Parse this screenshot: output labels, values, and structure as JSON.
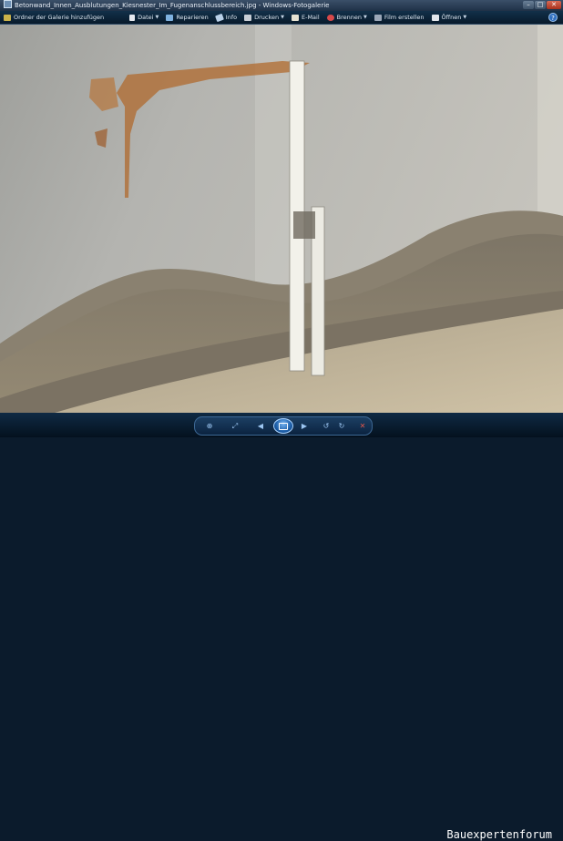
{
  "window": {
    "title": "Betonwand_Innen_Ausblutungen_Kiesnester_Im_Fugenanschlussbereich.jpg - Windows-Fotogalerie"
  },
  "toolbar": {
    "items": [
      {
        "label": "Ordner der Galerie hinzufügen",
        "icon": "folder-add-icon",
        "color": "#c9b24a",
        "dropdown": false
      },
      {
        "label": "Datei",
        "icon": "file-icon",
        "color": "#e6e9ef",
        "dropdown": true
      },
      {
        "label": "Reparieren",
        "icon": "fix-icon",
        "color": "#7fb2e0",
        "dropdown": false
      },
      {
        "label": "Info",
        "icon": "info-icon",
        "color": "#b9d0e8",
        "dropdown": false
      },
      {
        "label": "Drucken",
        "icon": "printer-icon",
        "color": "#c8ced6",
        "dropdown": true
      },
      {
        "label": "E-Mail",
        "icon": "email-icon",
        "color": "#e6e2d2",
        "dropdown": false
      },
      {
        "label": "Brennen",
        "icon": "burn-disc-icon",
        "color": "#d8494a",
        "dropdown": true
      },
      {
        "label": "Film erstellen",
        "icon": "film-icon",
        "color": "#9aa7b8",
        "dropdown": false
      },
      {
        "label": "Öffnen",
        "icon": "open-icon",
        "color": "#e2e6ec",
        "dropdown": true
      }
    ],
    "help": "?"
  },
  "controls": {
    "zoom": "zoom-icon",
    "fit": "fit-window-icon",
    "previous": "previous-icon",
    "slideshow": "slideshow-icon",
    "next": "next-icon",
    "rotate_ccw": "rotate-left-icon",
    "rotate_cw": "rotate-right-icon",
    "delete": "delete-icon"
  },
  "watermark": "Bauexpertenforum"
}
